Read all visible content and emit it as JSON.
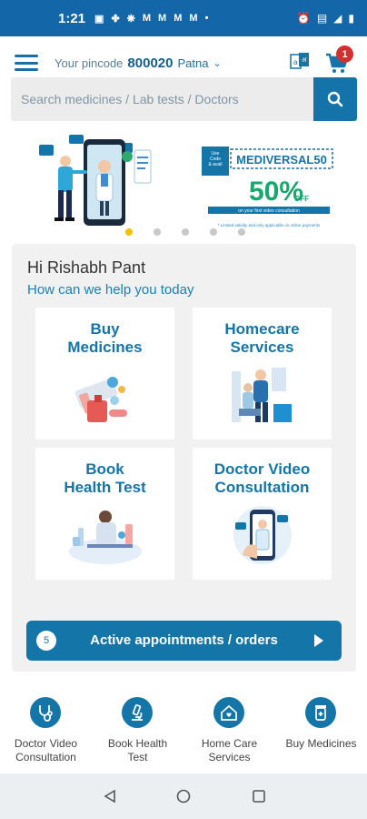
{
  "status_bar": {
    "time": "1:21",
    "icons": [
      "M",
      "M",
      "M",
      "M"
    ]
  },
  "header": {
    "pincode_label": "Your pincode",
    "pincode_value": "800020",
    "city": "Patna",
    "cart_count": "1"
  },
  "search": {
    "placeholder": "Search medicines / Lab tests / Doctors"
  },
  "banner": {
    "code_label": "Use\nCode\n& avail",
    "code": "MEDIVERSAL50",
    "discount": "50%",
    "off": "OFF",
    "offer_sub": "on your first video consultation",
    "terms": "* Limited validity and only applicable on online payments",
    "slide_count": 5,
    "active_slide": 0
  },
  "help": {
    "greeting": "Hi Rishabh Pant",
    "subtitle": "How can we help you today",
    "tiles": [
      {
        "label": "Buy\nMedicines"
      },
      {
        "label": "Homecare\nServices"
      },
      {
        "label": "Book\nHealth Test"
      },
      {
        "label": "Doctor Video\nConsultation"
      }
    ],
    "appointments_count": "5",
    "appointments_label": "Active appointments / orders"
  },
  "bottom_nav": [
    {
      "label": "Doctor Video\nConsultation",
      "icon": "stethoscope-icon"
    },
    {
      "label": "Book Health\nTest",
      "icon": "microscope-icon"
    },
    {
      "label": "Home Care\nServices",
      "icon": "home-care-icon"
    },
    {
      "label": "Buy Medicines",
      "icon": "pill-bottle-icon"
    }
  ],
  "colors": {
    "primary": "#1475a9",
    "status_bar": "#1366a8",
    "badge": "#d42f2f",
    "offer_green": "#17a86e"
  }
}
